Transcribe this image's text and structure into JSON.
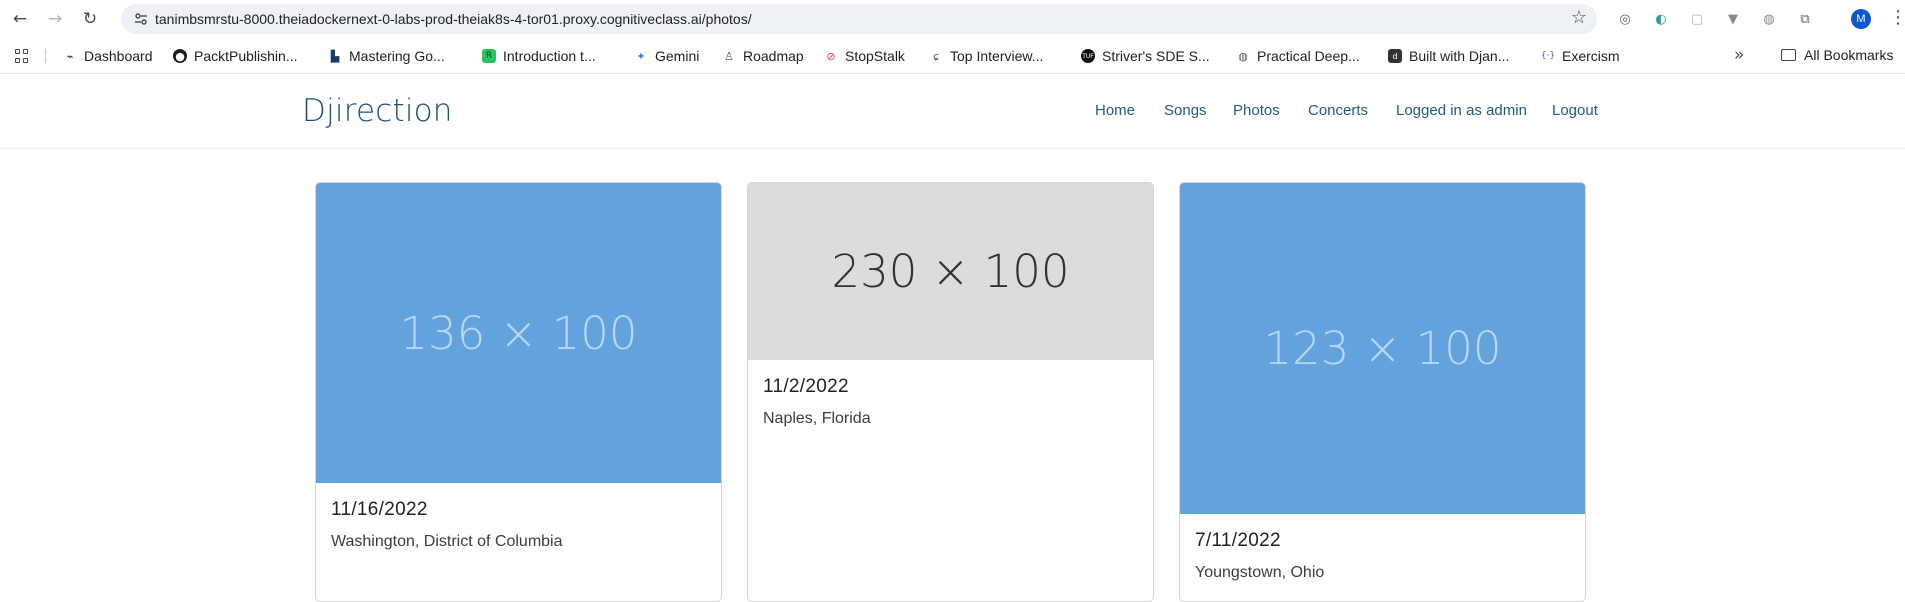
{
  "browser": {
    "url": "tanimbsmrstu-8000.theiadockernext-0-labs-prod-theiak8s-4-tor01.proxy.cognitiveclass.ai/photos/",
    "profile_initial": "M",
    "bookmarks": [
      {
        "label": "Dashboard",
        "icon": "dashboard-icon"
      },
      {
        "label": "PacktPublishin...",
        "icon": "github-icon"
      },
      {
        "label": "Mastering Go...",
        "icon": "gopher-icon"
      },
      {
        "label": "Introduction t...",
        "icon": "course-icon"
      },
      {
        "label": "Gemini",
        "icon": "gemini-icon"
      },
      {
        "label": "Roadmap",
        "icon": "roadmap-icon"
      },
      {
        "label": "StopStalk",
        "icon": "stopstalk-icon"
      },
      {
        "label": "Top Interview...",
        "icon": "leetcode-icon"
      },
      {
        "label": "Striver's SDE S...",
        "icon": "tuf-icon"
      },
      {
        "label": "Practical Deep...",
        "icon": "globe-icon"
      },
      {
        "label": "Built with Djan...",
        "icon": "django-icon"
      },
      {
        "label": "Exercism",
        "icon": "exercism-icon"
      }
    ],
    "all_bookmarks": "All Bookmarks",
    "more": "»"
  },
  "site": {
    "brand": "Djirection",
    "nav": [
      "Home",
      "Songs",
      "Photos",
      "Concerts",
      "Logged in as admin",
      "Logout"
    ]
  },
  "photos": [
    {
      "placeholder": "136 × 100",
      "date": "11/16/2022",
      "location": "Washington, District of Columbia",
      "color": "#62a2dd"
    },
    {
      "placeholder": "230 × 100",
      "date": "11/2/2022",
      "location": "Naples, Florida",
      "color": "#dcdcdc"
    },
    {
      "placeholder": "123 × 100",
      "date": "7/11/2022",
      "location": "Youngstown, Ohio",
      "color": "#62a2dd"
    }
  ]
}
